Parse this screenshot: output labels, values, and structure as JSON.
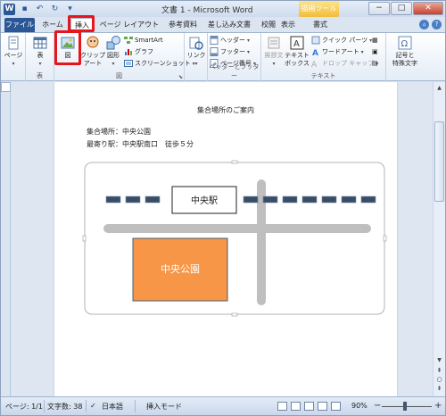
{
  "window": {
    "title": "文書 1 - Microsoft Word",
    "context_title": "描画ツール",
    "controls": [
      "−",
      "□",
      "✕"
    ]
  },
  "qat": {
    "undo": "↶",
    "redo": "↻",
    "logo": "W",
    "save": "▪"
  },
  "tabs": [
    {
      "label": "ファイル"
    },
    {
      "label": "ホーム"
    },
    {
      "label": "挿入"
    },
    {
      "label": "ページ レイアウト"
    },
    {
      "label": "参考資料"
    },
    {
      "label": "差し込み文書"
    },
    {
      "label": "校閲"
    },
    {
      "label": "表示"
    },
    {
      "label": "書式"
    }
  ],
  "ribbon": {
    "page": {
      "label": "ページ"
    },
    "table": {
      "label": "表",
      "group": "表"
    },
    "illustrations": {
      "picture_label": "図",
      "clipart_label": "クリップ\nアート",
      "shapes_label": "図形",
      "smartart": "SmartArt",
      "chart": "グラフ",
      "screenshot": "スクリーンショット",
      "group": "図"
    },
    "links": {
      "label": "リンク"
    },
    "header_footer": {
      "header": "ヘッダー",
      "footer": "フッター",
      "page_number": "ページ番号",
      "group": "ヘッダーとフッター"
    },
    "text": {
      "comment": "挨拶文",
      "textbox": "テキスト\nボックス",
      "quick_parts": "クイック パーツ",
      "wordart": "ワードアート",
      "dropcap": "ドロップ キャップ",
      "group": "テキスト"
    },
    "symbols": {
      "label": "記号と\n特殊文字"
    }
  },
  "document": {
    "heading": "集合場所のご案内",
    "lines": [
      "集合場所：中央公園",
      "最寄り駅：中央駅南口　徒歩５分"
    ],
    "map": {
      "station_label": "中央駅",
      "park_label": "中央公園",
      "park_color": "#f79646",
      "road_color": "#bfbfbf",
      "rail_color": "#3a4d64"
    }
  },
  "status": {
    "page": "ページ: 1/1",
    "words": "文字数: 38",
    "language": "日本語",
    "mode": "挿入モード",
    "zoom": "90%",
    "zoom_minus": "−",
    "zoom_plus": "+"
  },
  "colors": {
    "accent": "#2b5797",
    "highlight": "#e8161a"
  }
}
